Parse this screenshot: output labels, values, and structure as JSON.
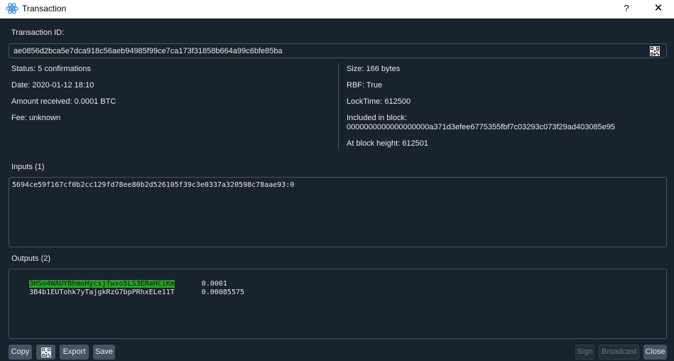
{
  "window": {
    "title": "Transaction",
    "help_label": "?",
    "close_label": "✕"
  },
  "txid": {
    "label": "Transaction ID:",
    "value": "ae0856d2bca5e7dca918c56aeb94985f99ce7ca173f31858b664a99c6bfe85ba"
  },
  "info_left": {
    "status": "Status: 5 confirmations",
    "date": "Date: 2020-01-12 18:10",
    "amount": "Amount received: 0.0001 BTC",
    "fee": "Fee: unknown"
  },
  "info_right": {
    "size": "Size: 166 bytes",
    "rbf": "RBF: True",
    "locktime": "LockTime: 612500",
    "block_label": "Included in block:",
    "block_hash": "0000000000000000000a371d3efee6775355fbf7c03293c073f29ad403085e95",
    "height": "At block height: 612501"
  },
  "inputs": {
    "label": "Inputs (1)",
    "items": [
      "5694ce59f167cf0b2cc129fd78ee80b2d526105f39c3e0337a320598c78aae93:0"
    ]
  },
  "outputs": {
    "label": "Outputs (2)",
    "items": [
      {
        "address": "3HSo4WAUYBhmoHycsjfwxo5LS3ERaHCiKm",
        "amount": "0.0001",
        "highlight_color": "#2ba02b"
      },
      {
        "address": "3B4b1EUTohk7yTajgkRzG7bpPRhxELe11T",
        "amount": "0.00085575"
      }
    ]
  },
  "buttons": {
    "copy": "Copy",
    "qr_icon": "qr-code-icon",
    "export": "Export",
    "save": "Save",
    "sign": "Sign",
    "broadcast": "Broadcast",
    "close": "Close"
  },
  "colors": {
    "background": "#19232d",
    "border": "#455364",
    "text": "#e6e8ea",
    "highlight": "#2ba02b",
    "titlebar": "#ffffff"
  }
}
